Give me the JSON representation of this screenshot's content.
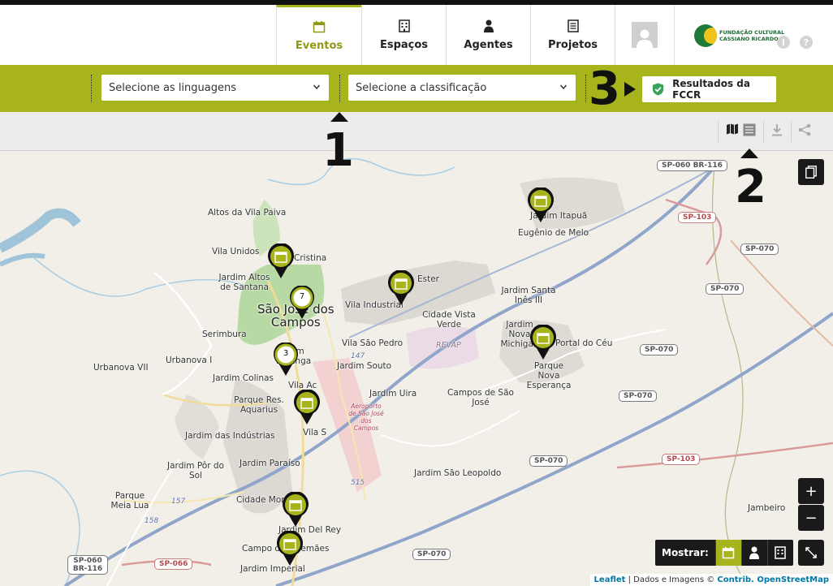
{
  "nav": {
    "tabs": [
      {
        "label": "Eventos",
        "icon": "calendar-icon",
        "active": true
      },
      {
        "label": "Espaços",
        "icon": "building-icon",
        "active": false
      },
      {
        "label": "Agentes",
        "icon": "person-icon",
        "active": false
      },
      {
        "label": "Projetos",
        "icon": "document-icon",
        "active": false
      }
    ],
    "logo_line1": "FUNDAÇÃO CULTURAL",
    "logo_line2": "CASSIANO RICARDO",
    "info_glyph": "i",
    "help_glyph": "?"
  },
  "filters": {
    "languages_placeholder": "Selecione as linguagens",
    "classification_placeholder": "Selecione a classificação",
    "results_button": "Resultados da FCCR"
  },
  "callouts": {
    "one": "1",
    "two": "2",
    "three": "3"
  },
  "map": {
    "city_name": "São José dos Campos",
    "city_line1": "São José dos",
    "city_line2": "Campos",
    "places": [
      "Altos da Vila Paiva",
      "Vila Unidos",
      "Jardim Altos de Santana",
      "Serimbura",
      "Urbanova I",
      "Jardim Colinas",
      "Parque Res. Aquarius",
      "Jardim das Indústrias",
      "Jardim Pôr do Sol",
      "Parque Meia Lua",
      "Jardim Paraíso",
      "Cidade Mor",
      "Jardim Del Rey",
      "Campo dos Alemães",
      "Jardim Imperial",
      "Vila Industrial",
      "Cidade Vista Verde",
      "Vila São Pedro",
      "Jardim Souto",
      "Jardim Uira",
      "Campos de São José",
      "Jardim São Leopoldo",
      "Jardim Itapuã",
      "Eugênio de Melo",
      "Jardim Santa Inês III",
      "Jardim Nova Michigan",
      "Portal do Céu",
      "Parque Nova Esperança",
      "Jambeiro",
      "REVAP",
      "Aeroporto de São José dos Campos",
      "Vila Ac",
      "Vila S",
      "Cristina",
      "Ester",
      "Jardim Ipiranga",
      "Urbanova VII"
    ],
    "shields": [
      "SP-060 BR-116",
      "SP-103",
      "SP-070",
      "SP-070",
      "SP-070",
      "SP-070",
      "SP-070",
      "SP-103",
      "SP-070",
      "SP-060 BR-116",
      "SP-066",
      "147",
      "157",
      "158",
      "515"
    ],
    "clusters": [
      "7",
      "3"
    ],
    "zoom_in": "+",
    "zoom_out": "−",
    "show_label": "Mostrar:",
    "attribution_link1": "Leaflet",
    "attribution_text": " | Dados e Imagens © ",
    "attribution_link2": "Contrib. OpenStreetMap"
  },
  "colors": {
    "accent": "#a8b41c",
    "dark": "#1a1a1a",
    "marker": "#8f9a12"
  }
}
